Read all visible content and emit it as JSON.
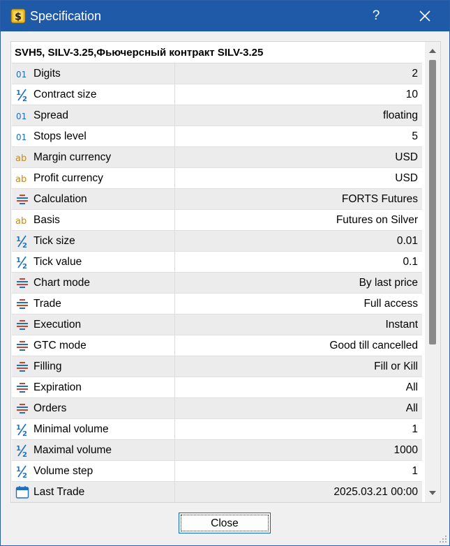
{
  "window": {
    "title": "Specification",
    "help_label": "?",
    "icon": "dollar-icon",
    "colors": {
      "titlebar": "#1e5aa8",
      "accent": "#0a64c8"
    }
  },
  "spec": {
    "header": "SVH5, SILV-3.25,Фьючерсный контракт SILV-3.25",
    "rows": [
      {
        "icon": "integer-icon",
        "label": "Digits",
        "value": "2"
      },
      {
        "icon": "fraction-icon",
        "label": "Contract size",
        "value": "10"
      },
      {
        "icon": "integer-icon",
        "label": "Spread",
        "value": "floating"
      },
      {
        "icon": "integer-icon",
        "label": "Stops level",
        "value": "5"
      },
      {
        "icon": "text-icon",
        "label": "Margin currency",
        "value": "USD"
      },
      {
        "icon": "text-icon",
        "label": "Profit currency",
        "value": "USD"
      },
      {
        "icon": "enum-icon",
        "label": "Calculation",
        "value": "FORTS Futures"
      },
      {
        "icon": "text-icon",
        "label": "Basis",
        "value": "Futures on Silver"
      },
      {
        "icon": "fraction-icon",
        "label": "Tick size",
        "value": "0.01"
      },
      {
        "icon": "fraction-icon",
        "label": "Tick value",
        "value": "0.1"
      },
      {
        "icon": "enum-icon",
        "label": "Chart mode",
        "value": "By last price"
      },
      {
        "icon": "enum-icon",
        "label": "Trade",
        "value": "Full access"
      },
      {
        "icon": "enum-icon",
        "label": "Execution",
        "value": "Instant"
      },
      {
        "icon": "enum-icon",
        "label": "GTC mode",
        "value": "Good till cancelled"
      },
      {
        "icon": "enum-icon",
        "label": "Filling",
        "value": "Fill or Kill"
      },
      {
        "icon": "enum-icon",
        "label": "Expiration",
        "value": "All"
      },
      {
        "icon": "enum-icon",
        "label": "Orders",
        "value": "All"
      },
      {
        "icon": "fraction-icon",
        "label": "Minimal volume",
        "value": "1"
      },
      {
        "icon": "fraction-icon",
        "label": "Maximal volume",
        "value": "1000"
      },
      {
        "icon": "fraction-icon",
        "label": "Volume step",
        "value": "1"
      },
      {
        "icon": "calendar-icon",
        "label": "Last Trade",
        "value": "2025.03.21 00:00"
      }
    ]
  },
  "footer": {
    "close_label": "Close"
  }
}
